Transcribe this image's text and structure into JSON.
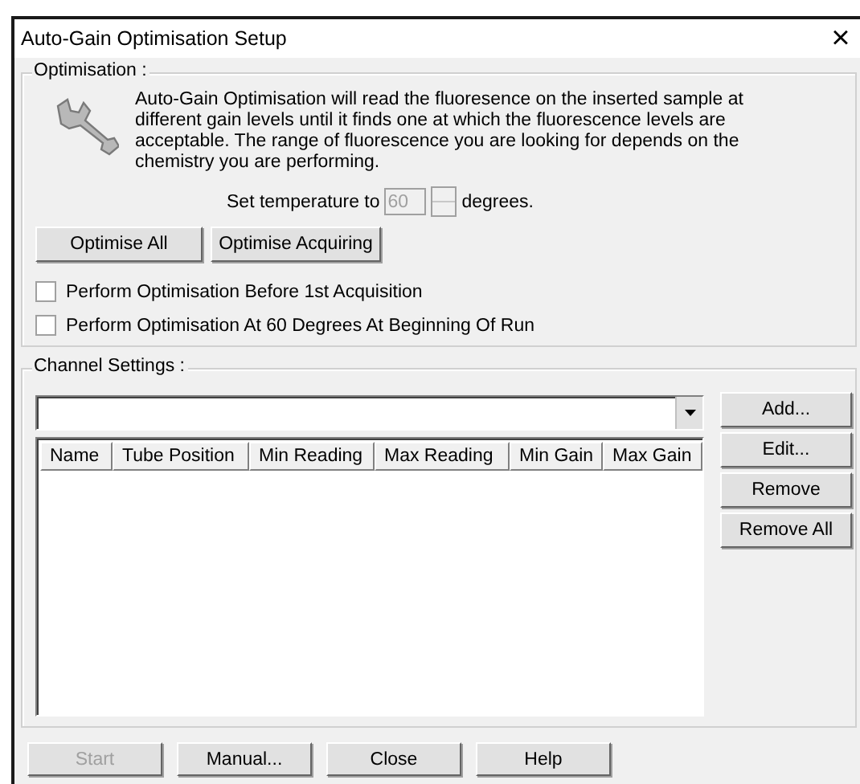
{
  "window": {
    "title": "Auto-Gain Optimisation Setup",
    "close_glyph": "×"
  },
  "optimisation": {
    "legend": "Optimisation :",
    "description": "Auto-Gain Optimisation will read the fluoresence on the inserted sample at different gain levels until it finds one at which the fluorescence levels are acceptable. The range of fluorescence you are looking for depends on the chemistry you are performing.",
    "temperature": {
      "label": "Set temperature to",
      "value": "60",
      "disabled": true,
      "unit": "degrees."
    },
    "buttons": [
      {
        "label": "Optimise All",
        "disabled": false
      },
      {
        "label": "Optimise Acquiring",
        "disabled": false
      }
    ],
    "options": [
      {
        "label": "Perform Optimisation Before 1st Acquisition",
        "checked": false
      },
      {
        "label": "Perform Optimisation At 60 Degrees At Beginning Of Run",
        "checked": false
      }
    ]
  },
  "channel_settings": {
    "legend": "Channel Settings :",
    "table": {
      "columns": [
        "Name",
        "Tube Position",
        "Min Reading",
        "Max Reading",
        "Min Gain",
        "Max Gain"
      ]
    },
    "buttons": [
      {
        "label": "Add...",
        "disabled": false
      },
      {
        "label": "Edit...",
        "disabled": false
      },
      {
        "label": "Remove",
        "disabled": false
      },
      {
        "label": "Remove All",
        "disabled": false
      }
    ]
  },
  "footer_buttons": [
    {
      "label": "Start",
      "disabled": true
    },
    {
      "label": "Manual...",
      "disabled": false
    },
    {
      "label": "Close",
      "disabled": false
    },
    {
      "label": "Help",
      "disabled": false
    }
  ]
}
